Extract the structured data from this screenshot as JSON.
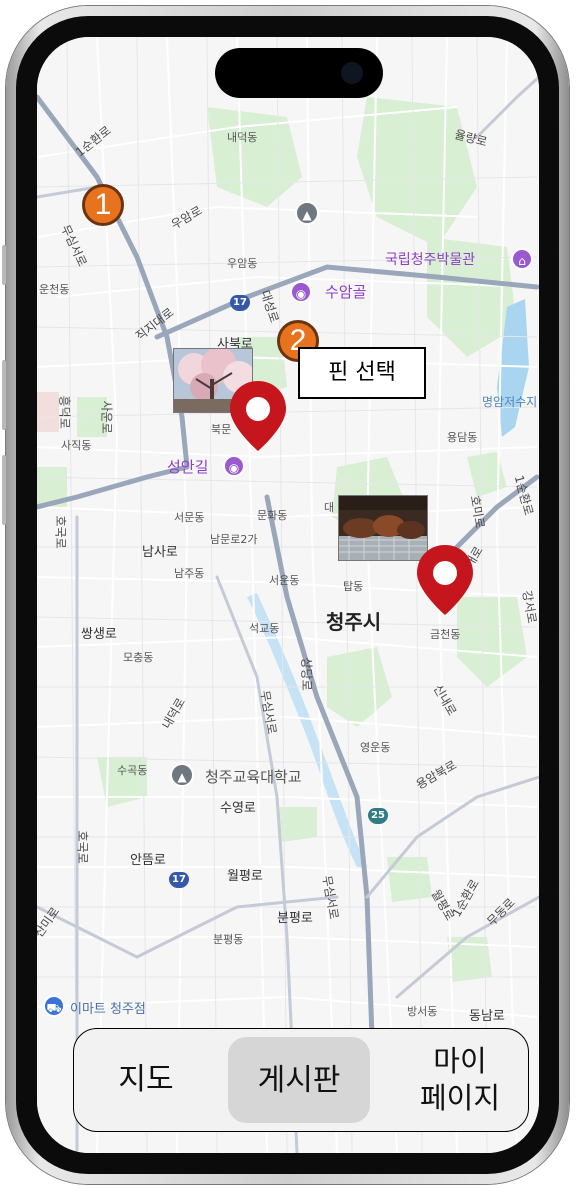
{
  "map": {
    "labels": {
      "sunhwan_1_nw": "1순환로",
      "yuldong": "율량로",
      "naeduk": "내덕동",
      "uamro": "우암로",
      "musimseoro_n": "무심서로",
      "uamdong": "우암동",
      "cheondong": "운천동",
      "jikjidaero": "직지대로",
      "daeseongro": "대성로",
      "sabukro": "사북로",
      "heungdeokro": "흥덕로",
      "sachangro": "사운로",
      "bukmun": "북문",
      "sajikdong": "사직동",
      "yongdam": "용담동",
      "seomun": "서문동",
      "munhwa": "문화동",
      "dae": "대",
      "namsaro": "남사로",
      "nammunro": "남문로2가",
      "hoduro": "호국로",
      "namju": "남주동",
      "seoun": "서운동",
      "tap": "탑동",
      "ssaengsaengro": "쌍생로",
      "seokgyo": "석교동",
      "geumcheon": "금천동",
      "mochung": "모충동",
      "sangdangro": "상당로",
      "naedeokro": "내덕로",
      "musimseoro": "무심서로",
      "yeongundong": "영운동",
      "yongambukro": "용암북로",
      "sugok": "수곡동",
      "suyeongro": "수영로",
      "andeumro": "안뜸로",
      "wolpyeongro": "월평로",
      "bunpyeongro": "분평로",
      "musimseoro_s": "무심서로",
      "sanmiro": "산미로",
      "bunpyeongdong": "분평동",
      "sunhwan_1_se": "1순환로",
      "wolpyeongro2": "월평로",
      "mudongro": "무동로",
      "bangseodong": "방서동",
      "dongnamro": "동남로",
      "hongmiro": "호미로",
      "jungogaero": "중고개로",
      "sinaro": "신내로",
      "sunhwan_1_e": "1순환로",
      "gangseo": "강서로",
      "museum": "국립청주박물관",
      "suamgol": "수암골",
      "seonganggil": "성안길",
      "myeongamreservoir": "명암저수지",
      "cheongju_city": "청주시",
      "university": "청주교육대학교",
      "emart": "이마트 청주점",
      "hwy17a": "17",
      "hwy17b": "17",
      "hwy25": "25"
    },
    "colors": {
      "background": "#f8f8f8",
      "green_area": "#d5efd1",
      "water": "#a8d4f0",
      "major_road": "#8e9bb0",
      "road": "#ffffff",
      "pin": "#c4161c"
    }
  },
  "annotations": {
    "step1": "1",
    "step2": "2",
    "callout": "핀 선택",
    "badge_color": "#e8731f"
  },
  "photos": {
    "photo1_alt": "cherry-blossom-photo",
    "photo2_alt": "grilled-meat-photo"
  },
  "nav": {
    "map": "지도",
    "board": "게시판",
    "mypage": "마이\n페이지"
  }
}
